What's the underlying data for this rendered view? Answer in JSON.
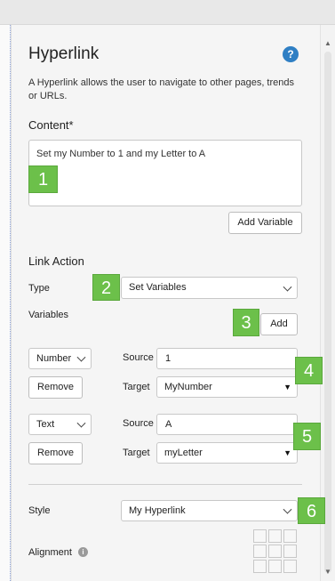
{
  "panel": {
    "title": "Hyperlink",
    "description": "A Hyperlink allows the user to navigate to other pages, trends or URLs."
  },
  "content": {
    "label": "Content*",
    "value": "Set my Number to 1 and my Letter to A",
    "add_variable_label": "Add Variable"
  },
  "link_action": {
    "heading": "Link Action",
    "type_label": "Type",
    "type_value": "Set Variables",
    "variables_label": "Variables",
    "add_label": "Add"
  },
  "variables": [
    {
      "type": "Number",
      "source_label": "Source",
      "source_value": "1",
      "target_label": "Target",
      "target_value": "MyNumber",
      "remove_label": "Remove"
    },
    {
      "type": "Text",
      "source_label": "Source",
      "source_value": "A",
      "target_label": "Target",
      "target_value": "myLetter",
      "remove_label": "Remove"
    }
  ],
  "style": {
    "label": "Style",
    "value": "My Hyperlink"
  },
  "alignment": {
    "label": "Alignment"
  },
  "callouts": [
    "1",
    "2",
    "3",
    "4",
    "5",
    "6"
  ],
  "colors": {
    "callout": "#6cc04a",
    "help": "#2f7fc4",
    "panel": "#f5f5f5"
  },
  "icons": {
    "help": "help-icon",
    "info": "info-icon",
    "chevron": "chevron-down-icon",
    "dropdown": "dropdown-triangle-icon"
  }
}
